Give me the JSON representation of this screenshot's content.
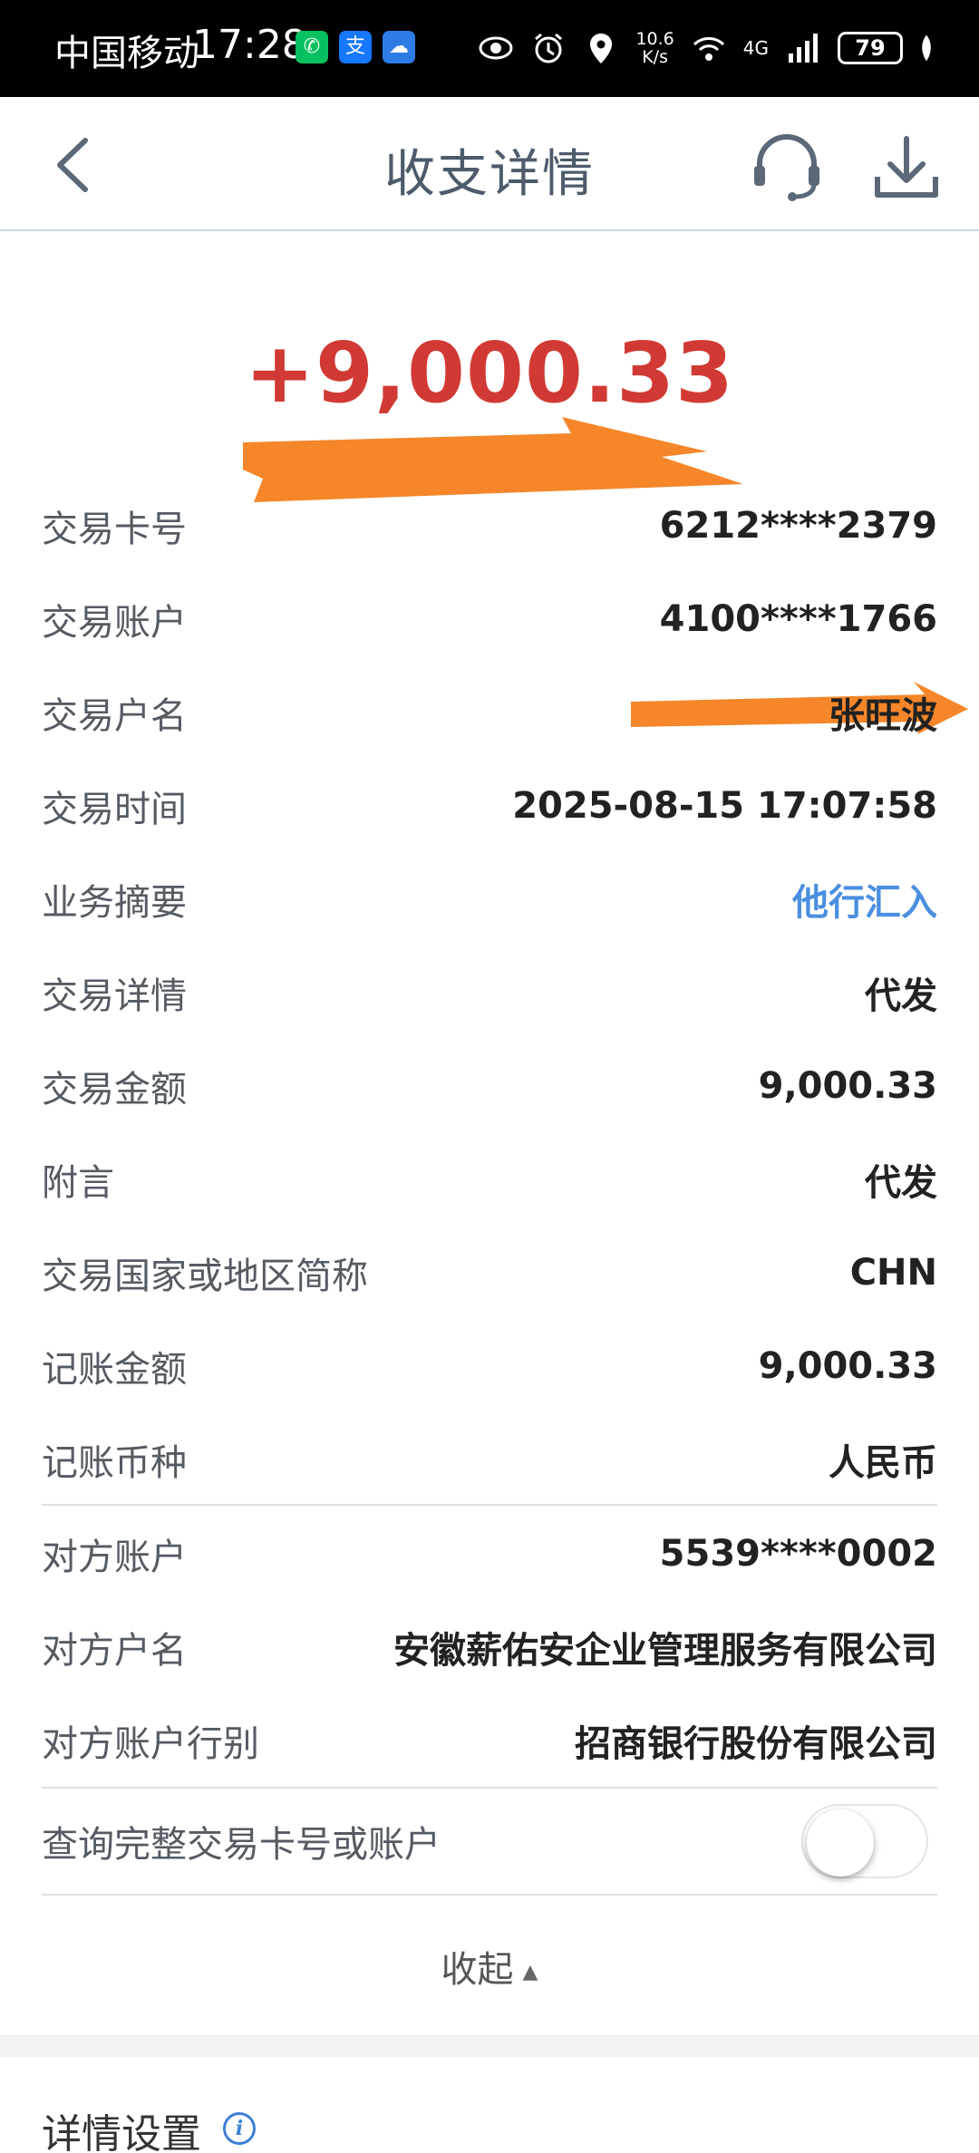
{
  "status_bar": {
    "carrier": "中国移动",
    "time": "17:28",
    "apps": [
      {
        "name": "wechat-icon",
        "color": "#07c160",
        "glyph": "✆"
      },
      {
        "name": "alipay-icon",
        "color": "#1677ff",
        "glyph": "支"
      },
      {
        "name": "weather-icon",
        "color": "#2f7be6",
        "glyph": "☁"
      }
    ],
    "net_speed_value": "10.6",
    "net_speed_unit": "K/s",
    "network": "4G",
    "battery": "79"
  },
  "nav": {
    "title": "收支详情"
  },
  "amount": "+9,000.33",
  "colors": {
    "amount": "#d13a34",
    "link": "#4a8fe0",
    "scribble": "#f5862a"
  },
  "details": [
    {
      "label": "交易卡号",
      "value": "6212****2379"
    },
    {
      "label": "交易账户",
      "value": "4100****1766"
    },
    {
      "label": "交易户名",
      "value": "张旺波"
    },
    {
      "label": "交易时间",
      "value": "2025-08-15 17:07:58"
    },
    {
      "label": "业务摘要",
      "value": "他行汇入"
    },
    {
      "label": "交易详情",
      "value": "代发"
    },
    {
      "label": "交易金额",
      "value": "9,000.33"
    },
    {
      "label": "附言",
      "value": "代发"
    },
    {
      "label": "交易国家或地区简称",
      "value": "CHN"
    },
    {
      "label": "记账金额",
      "value": "9,000.33"
    },
    {
      "label": "记账币种",
      "value": "人民币"
    }
  ],
  "counterparty": [
    {
      "label": "对方账户",
      "value": "5539****0002"
    },
    {
      "label": "对方户名",
      "value": "安徽薪佑安企业管理服务有限公司"
    },
    {
      "label": "对方账户行别",
      "value": "招商银行股份有限公司"
    }
  ],
  "toggle": {
    "label": "查询完整交易卡号或账户",
    "on": false
  },
  "collapse_label": "收起",
  "settings_title": "详情设置"
}
